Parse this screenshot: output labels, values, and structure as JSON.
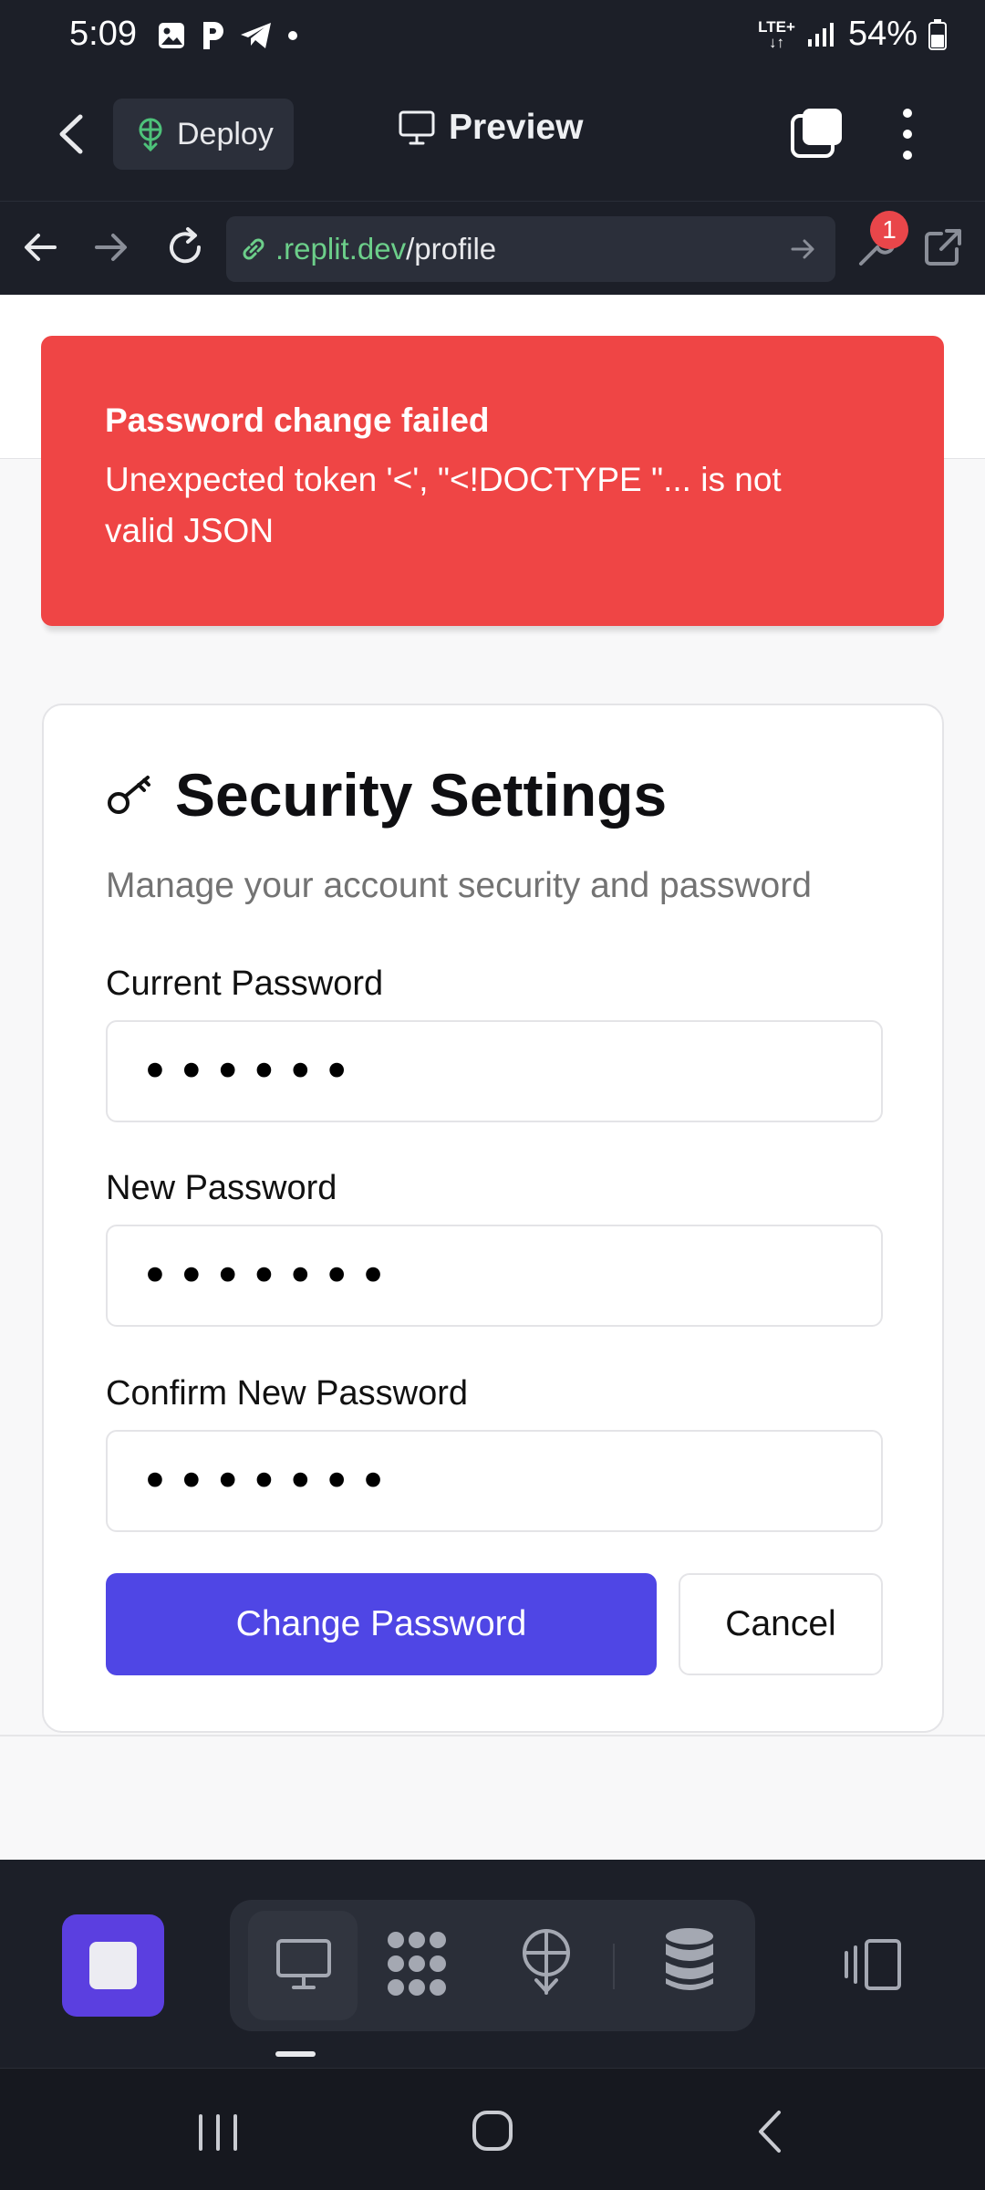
{
  "status_bar": {
    "time": "5:09",
    "network": "LTE+",
    "battery": "54%",
    "icons": [
      "gallery-icon",
      "p-icon",
      "telegram-icon",
      "dot-icon",
      "signal-icon",
      "battery-icon"
    ]
  },
  "top_bar": {
    "deploy_label": "Deploy",
    "preview_label": "Preview"
  },
  "url_bar": {
    "host": ".replit.dev",
    "path": "/profile",
    "badge_count": "1"
  },
  "toast": {
    "title": "Password change failed",
    "message": "Unexpected token '<', \"<!DOCTYPE \"... is not valid JSON",
    "color": "#ef4545"
  },
  "card": {
    "title": "Security Settings",
    "subtitle": "Manage your account security and password",
    "fields": [
      {
        "label": "Current Password",
        "value": "••••••"
      },
      {
        "label": "New Password",
        "value": "•••••••"
      },
      {
        "label": "Confirm New Password",
        "value": "•••••••"
      }
    ],
    "primary_button": "Change Password",
    "cancel_button": "Cancel",
    "accent": "#4f46e5"
  }
}
